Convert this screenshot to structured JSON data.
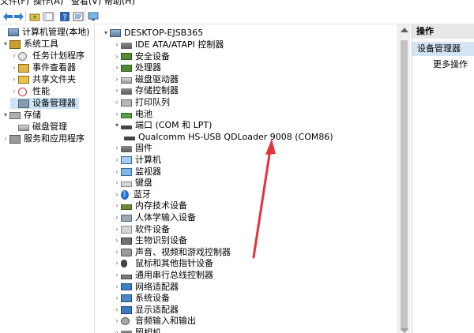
{
  "menubar": {
    "items": [
      "文件(F)",
      "操作(A)",
      "查看(V)",
      "帮助(H)"
    ]
  },
  "toolbar": {
    "buttons": [
      "back-icon",
      "forward-icon",
      "up-folder-icon",
      "show-hide-tree-icon",
      "help-icon",
      "properties-icon",
      "monitor-icon"
    ]
  },
  "left_tree": {
    "items": [
      {
        "label": "计算机管理(本地)",
        "level": 0,
        "expander": "",
        "icon": "computer-management-icon"
      },
      {
        "label": "系统工具",
        "level": 1,
        "expander": "▾",
        "icon": "system-tools-icon"
      },
      {
        "label": "任务计划程序",
        "level": 2,
        "expander": "›",
        "icon": "task-scheduler-icon"
      },
      {
        "label": "事件查看器",
        "level": 2,
        "expander": "›",
        "icon": "event-viewer-icon"
      },
      {
        "label": "共享文件夹",
        "level": 2,
        "expander": "›",
        "icon": "shared-folders-icon"
      },
      {
        "label": "性能",
        "level": 2,
        "expander": "›",
        "icon": "performance-icon"
      },
      {
        "label": "设备管理器",
        "level": 2,
        "expander": "",
        "icon": "device-manager-icon",
        "selected": true
      },
      {
        "label": "存储",
        "level": 1,
        "expander": "▾",
        "icon": "storage-icon"
      },
      {
        "label": "磁盘管理",
        "level": 2,
        "expander": "",
        "icon": "disk-management-icon"
      },
      {
        "label": "服务和应用程序",
        "level": 1,
        "expander": "›",
        "icon": "services-apps-icon"
      }
    ]
  },
  "device_tree": {
    "root": "DESKTOP-EJSB365",
    "items": [
      {
        "label": "IDE ATA/ATAPI 控制器",
        "icon": "ide-controller-icon",
        "cls": "i-dev",
        "expander": "›"
      },
      {
        "label": "安全设备",
        "icon": "security-device-icon",
        "cls": "i-chip",
        "expander": "›"
      },
      {
        "label": "处理器",
        "icon": "processor-icon",
        "cls": "i-chip",
        "expander": "›"
      },
      {
        "label": "磁盘驱动器",
        "icon": "disk-drive-icon",
        "cls": "i-disk",
        "expander": "›"
      },
      {
        "label": "存储控制器",
        "icon": "storage-controller-icon",
        "cls": "i-dev",
        "expander": "›"
      },
      {
        "label": "打印队列",
        "icon": "print-queue-icon",
        "cls": "i-print",
        "expander": "›"
      },
      {
        "label": "电池",
        "icon": "battery-icon",
        "cls": "i-batt",
        "expander": "›"
      },
      {
        "label": "端口 (COM 和 LPT)",
        "icon": "port-icon",
        "cls": "i-port",
        "expander": "▾"
      },
      {
        "label": "Qualcomm HS-USB QDLoader 9008 (COM86)",
        "icon": "com-port-icon",
        "cls": "i-port",
        "expander": "",
        "child": true
      },
      {
        "label": "固件",
        "icon": "firmware-icon",
        "cls": "i-dev",
        "expander": "›"
      },
      {
        "label": "计算机",
        "icon": "computer-icon",
        "cls": "i-comp",
        "expander": "›"
      },
      {
        "label": "监视器",
        "icon": "monitor-icon",
        "cls": "i-mon",
        "expander": "›"
      },
      {
        "label": "键盘",
        "icon": "keyboard-icon",
        "cls": "i-key",
        "expander": "›"
      },
      {
        "label": "蓝牙",
        "icon": "bluetooth-icon",
        "cls": "i-bt",
        "expander": "›"
      },
      {
        "label": "内存技术设备",
        "icon": "memory-device-icon",
        "cls": "i-mem",
        "expander": "›"
      },
      {
        "label": "人体学输入设备",
        "icon": "hid-icon",
        "cls": "i-hid",
        "expander": "›"
      },
      {
        "label": "软件设备",
        "icon": "software-device-icon",
        "cls": "i-sw",
        "expander": "›"
      },
      {
        "label": "生物识别设备",
        "icon": "biometric-icon",
        "cls": "i-bio",
        "expander": "›"
      },
      {
        "label": "声音、视频和游戏控制器",
        "icon": "sound-video-icon",
        "cls": "i-snd",
        "expander": "›"
      },
      {
        "label": "鼠标和其他指针设备",
        "icon": "mouse-icon",
        "cls": "i-mouse",
        "expander": "›"
      },
      {
        "label": "通用串行总线控制器",
        "icon": "usb-controller-icon",
        "cls": "i-usb",
        "expander": "›"
      },
      {
        "label": "网络适配器",
        "icon": "network-adapter-icon",
        "cls": "i-net",
        "expander": "›"
      },
      {
        "label": "系统设备",
        "icon": "system-device-icon",
        "cls": "i-sys",
        "expander": "›"
      },
      {
        "label": "显示适配器",
        "icon": "display-adapter-icon",
        "cls": "i-disp",
        "expander": "›"
      },
      {
        "label": "音频输入和输出",
        "icon": "audio-io-icon",
        "cls": "i-audio",
        "expander": "›"
      },
      {
        "label": "照相机",
        "icon": "camera-icon",
        "cls": "i-dev",
        "expander": "›"
      }
    ]
  },
  "actions": {
    "header": "操作",
    "section": "设备管理器",
    "more": "更多操作"
  },
  "colors": {
    "selection": "#cce4f7",
    "actions_section": "#d5e4f4",
    "annotation_arrow": "#e8313b"
  }
}
